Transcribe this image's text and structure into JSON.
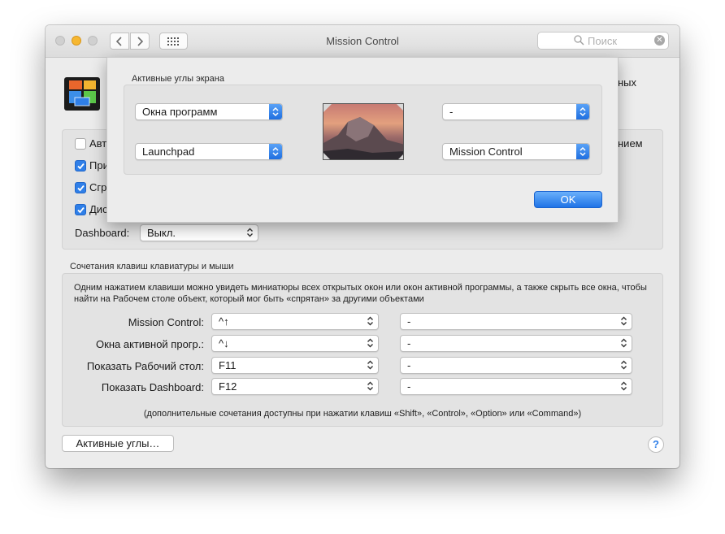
{
  "window": {
    "title": "Mission Control",
    "search_placeholder": "Поиск",
    "top_right_text": "ных",
    "side_right_text": "нием"
  },
  "options": {
    "checkbox_labels": [
      "Авт",
      "При",
      "Сгр",
      "Дис"
    ],
    "checkbox_states": [
      false,
      true,
      true,
      true
    ],
    "dashboard_label": "Dashboard:",
    "dashboard_value": "Выкл."
  },
  "shortcuts": {
    "caption": "Сочетания клавиш клавиатуры и мыши",
    "description": "Одним нажатием клавиши можно увидеть миниатюры всех открытых окон или окон активной программы, а также скрыть все окна, чтобы найти на Рабочем столе объект, который мог быть «спрятан» за другими объектами",
    "rows": [
      {
        "label": "Mission Control:",
        "key": "^↑",
        "mouse": "-"
      },
      {
        "label": "Окна активной прогр.:",
        "key": "^↓",
        "mouse": "-"
      },
      {
        "label": "Показать Рабочий стол:",
        "key": "F11",
        "mouse": "-"
      },
      {
        "label": "Показать Dashboard:",
        "key": "F12",
        "mouse": "-"
      }
    ],
    "note": "(дополнительные сочетания доступны при нажатии клавиш «Shift», «Control», «Option» или «Command»)"
  },
  "footer": {
    "hot_corners_button": "Активные углы…",
    "help": "?"
  },
  "sheet": {
    "caption": "Активные углы экрана",
    "top_left": "Окна программ",
    "top_right": "-",
    "bottom_left": "Launchpad",
    "bottom_right": "Mission Control",
    "ok_label": "OK"
  },
  "colors": {
    "accent": "#2f7fe8",
    "minimize": "#f6b731",
    "window_bg": "#ececec"
  }
}
